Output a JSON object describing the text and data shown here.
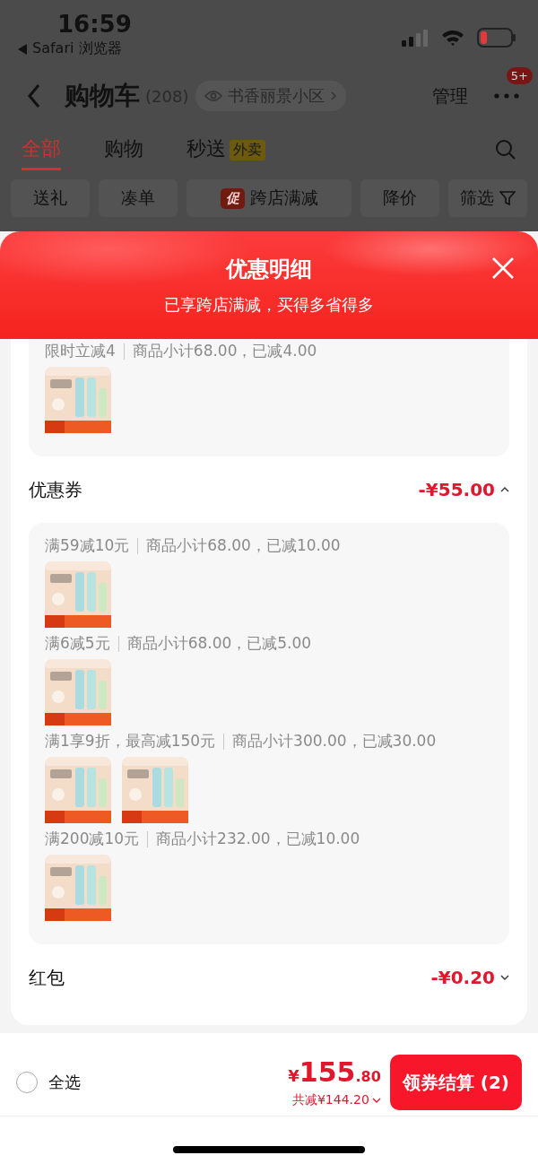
{
  "status_bar": {
    "time": "16:59",
    "back_app": "Safari 浏览器"
  },
  "header": {
    "title": "购物车",
    "count": "(208)",
    "address": "书香丽景小区",
    "manage": "管理",
    "more_badge": "5+"
  },
  "tabs": [
    {
      "label": "全部",
      "selected": true
    },
    {
      "label": "购物",
      "selected": false
    },
    {
      "label": "秒送",
      "selected": false,
      "tag": "外卖"
    }
  ],
  "filters": [
    {
      "kind": "plain",
      "label": "送礼"
    },
    {
      "kind": "plain",
      "label": "凑单"
    },
    {
      "kind": "promo",
      "label": "跨店满减",
      "tag": "促"
    },
    {
      "kind": "plain",
      "label": "降价"
    },
    {
      "kind": "filter",
      "label": "筛选"
    }
  ],
  "sheet": {
    "title": "优惠明细",
    "subtitle": "已享跨店满减，买得多省得多",
    "sections": [
      {
        "entries": [
          {
            "rule": "限时立减4",
            "detail": "商品小计68.00，已减4.00"
          }
        ]
      },
      {
        "title": "优惠券",
        "amount": "-¥55.00",
        "expanded": true,
        "entries": [
          {
            "rule": "满59减10元",
            "detail": "商品小计68.00，已减10.00"
          },
          {
            "rule": "满6减5元",
            "detail": "商品小计68.00，已减5.00"
          },
          {
            "rule": "满1享9折，最高减150元",
            "detail": "商品小计300.00，已减30.00"
          },
          {
            "rule": "满200减10元",
            "detail": "商品小计232.00，已减10.00"
          }
        ]
      },
      {
        "title": "红包",
        "amount": "-¥0.20",
        "expanded": false
      }
    ]
  },
  "footer": {
    "select_all": {
      "label": "全选",
      "checked": false
    },
    "currency": "¥",
    "price_integer": "155",
    "price_decimal": ".80",
    "saving": "共减¥144.20",
    "checkout": "领券结算 (2)"
  }
}
